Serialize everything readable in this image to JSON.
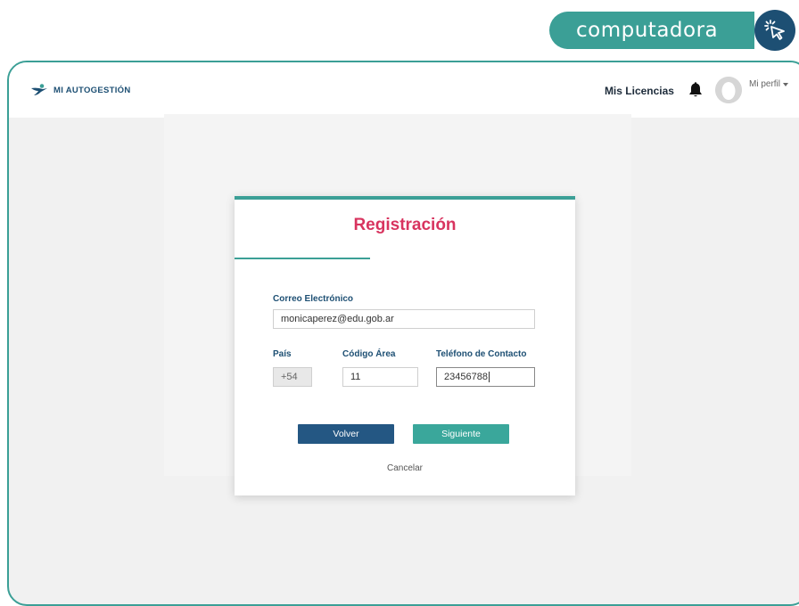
{
  "badge": {
    "label": "computadora"
  },
  "header": {
    "brand": "MI AUTOGESTIÓN",
    "licenses_link": "Mis Licencias",
    "profile_label": "Mi perfil"
  },
  "form": {
    "title": "Registración",
    "email": {
      "label": "Correo Electrónico",
      "value": "monicaperez@edu.gob.ar"
    },
    "country": {
      "label": "País",
      "value": "+54"
    },
    "area_code": {
      "label": "Código Área",
      "value": "11"
    },
    "phone": {
      "label": "Teléfono de Contacto",
      "value": "23456788"
    },
    "back_button": "Volver",
    "next_button": "Siguiente",
    "cancel_link": "Cancelar"
  },
  "colors": {
    "accent_teal": "#3b9f96",
    "title_red": "#d8345f",
    "navy": "#1d4f73",
    "back_button": "#245783",
    "next_button": "#3aa79b"
  }
}
